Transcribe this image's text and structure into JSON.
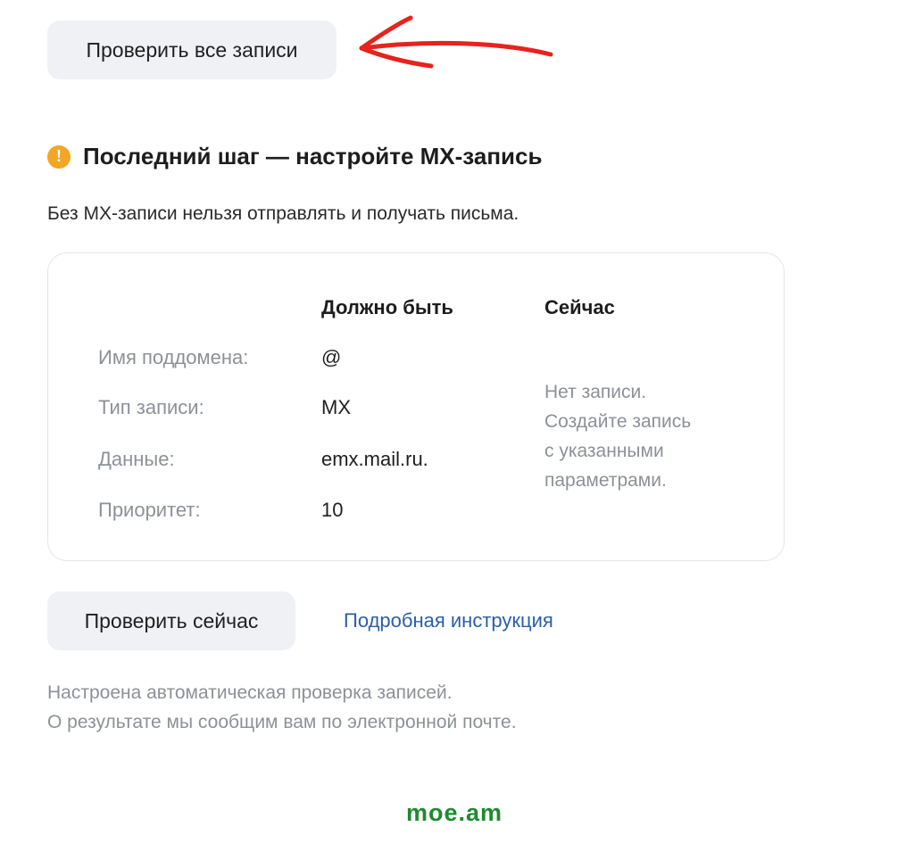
{
  "top_button": {
    "label": "Проверить все записи"
  },
  "annotation": {
    "arrow_color": "#e8221d"
  },
  "section": {
    "icon": "exclamation-icon",
    "icon_color": "#f3a523",
    "title": "Последний шаг — настройте MX-запись",
    "subtitle": "Без MX-записи нельзя отправлять и получать письма."
  },
  "record_table": {
    "col_should": "Должно быть",
    "col_now": "Сейчас",
    "rows": [
      {
        "label": "Имя поддомена:",
        "value": "@"
      },
      {
        "label": "Тип записи:",
        "value": "MX"
      },
      {
        "label": "Данные:",
        "value": "emx.mail.ru."
      },
      {
        "label": "Приоритет:",
        "value": "10"
      }
    ],
    "current_status": {
      "line1": "Нет записи.",
      "line2": "Создайте запись",
      "line3": "с указанными",
      "line4": "параметрами."
    }
  },
  "actions": {
    "check_now_label": "Проверить сейчас",
    "instruction_link": "Подробная инструкция",
    "link_color": "#2a5fa8"
  },
  "footer": {
    "line1": "Настроена автоматическая проверка записей.",
    "line2": "О результате мы сообщим вам по электронной почте."
  },
  "watermark": {
    "text": "moe.am",
    "color": "#1f8a2e"
  }
}
